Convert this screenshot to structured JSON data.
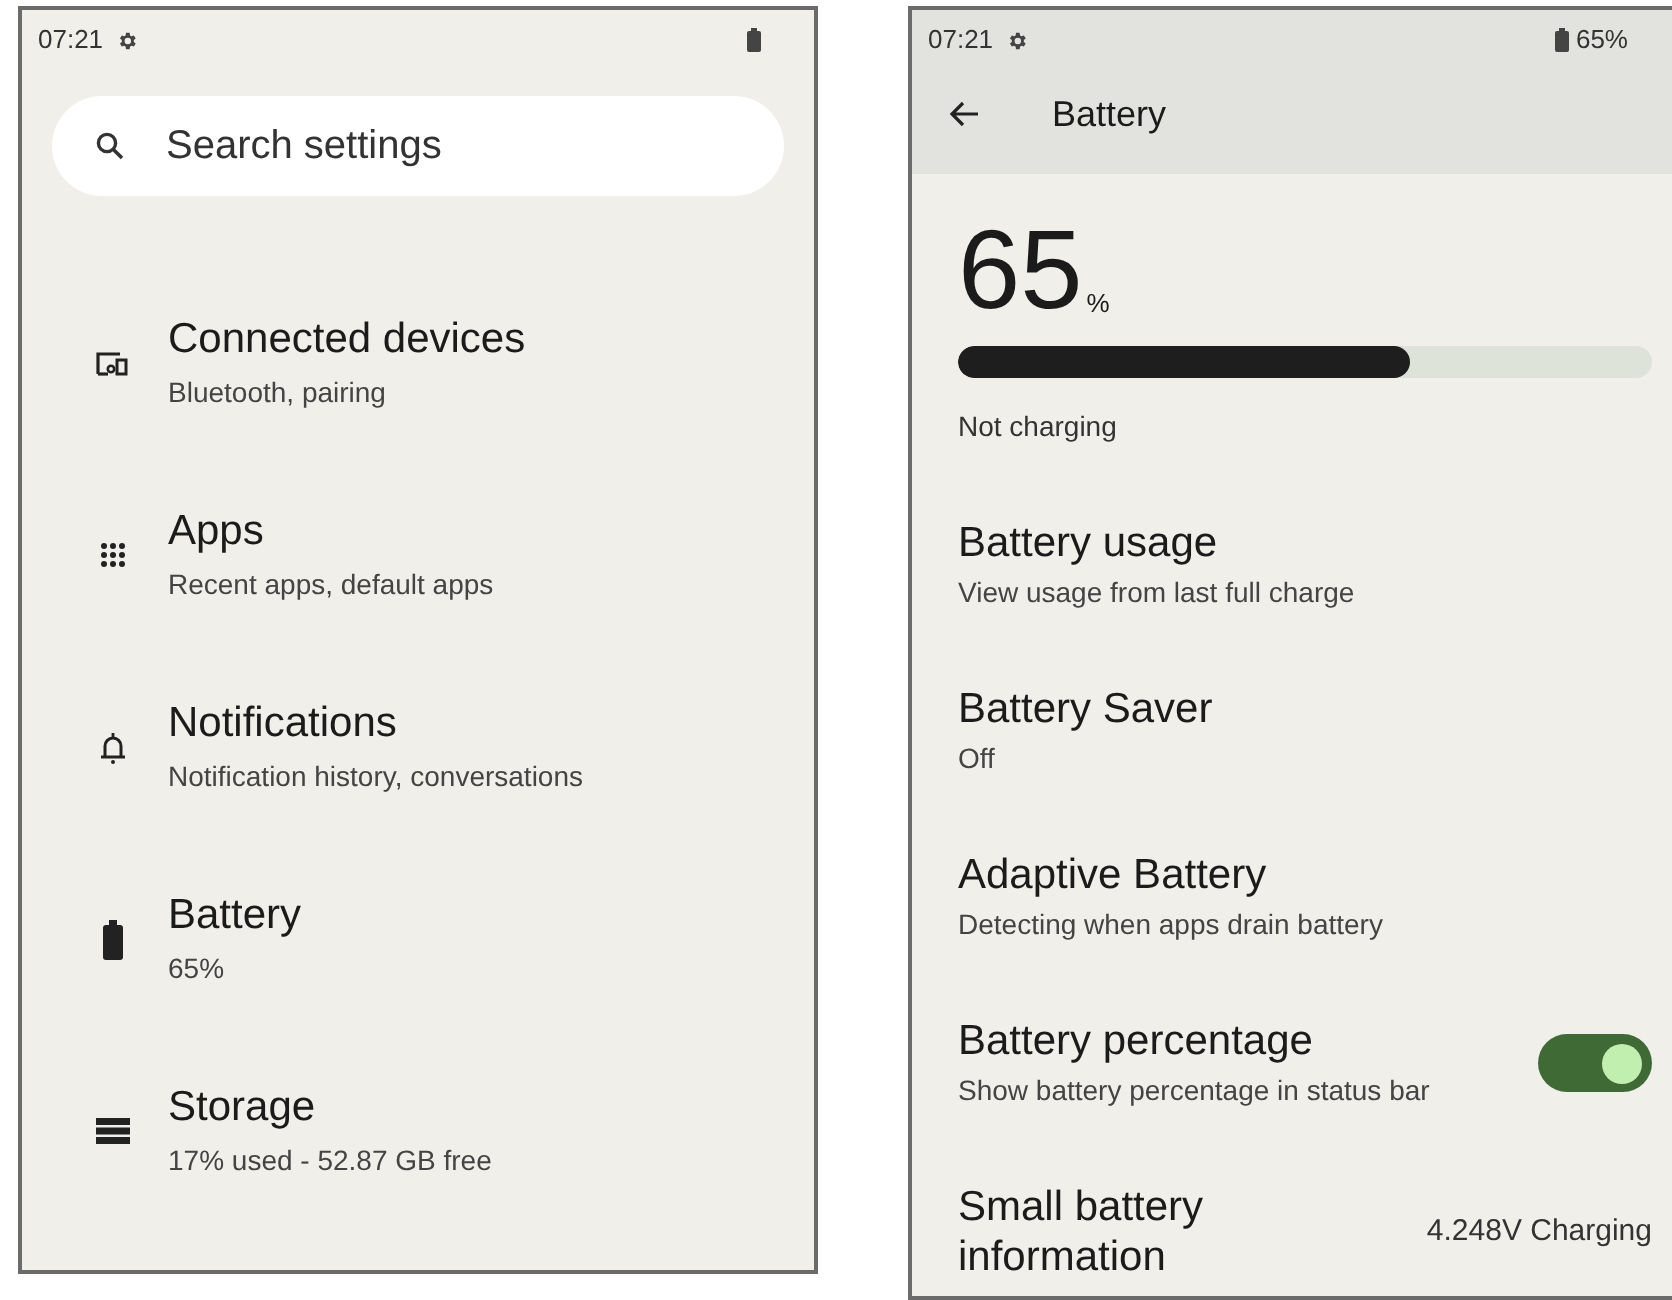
{
  "settings_screen": {
    "status_bar": {
      "time": "07:21"
    },
    "search": {
      "placeholder": "Search settings"
    },
    "items": [
      {
        "kind": "devices",
        "title": "Connected devices",
        "subtitle": "Bluetooth, pairing"
      },
      {
        "kind": "apps",
        "title": "Apps",
        "subtitle": "Recent apps, default apps"
      },
      {
        "kind": "notifications",
        "title": "Notifications",
        "subtitle": "Notification history, conversations"
      },
      {
        "kind": "battery",
        "title": "Battery",
        "subtitle": "65%"
      },
      {
        "kind": "storage",
        "title": "Storage",
        "subtitle": "17% used - 52.87 GB free"
      }
    ]
  },
  "battery_screen": {
    "status_bar": {
      "time": "07:21",
      "battery": "65%"
    },
    "title": "Battery",
    "percent": {
      "value": "65",
      "unit": "%"
    },
    "meter": {
      "level": 0.65
    },
    "status": "Not charging",
    "items": [
      {
        "kind": "text",
        "title": "Battery usage",
        "subtitle": "View usage from last full charge"
      },
      {
        "kind": "text",
        "title": "Battery Saver",
        "subtitle": "Off"
      },
      {
        "kind": "text",
        "title": "Adaptive Battery",
        "subtitle": "Detecting when apps drain battery"
      },
      {
        "kind": "toggle",
        "title": "Battery percentage",
        "subtitle": "Show battery percentage in status bar",
        "on": true
      },
      {
        "kind": "value",
        "title": "Small battery information",
        "value": "4.248V Charging"
      }
    ]
  }
}
